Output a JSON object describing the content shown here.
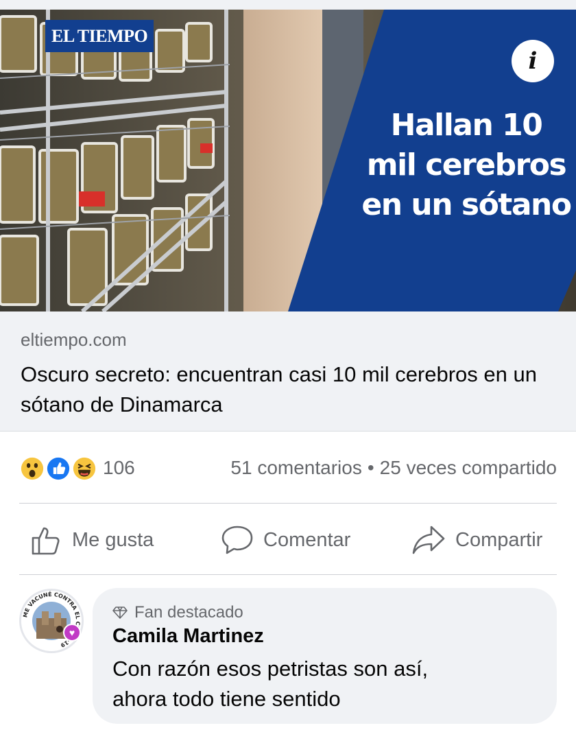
{
  "preview": {
    "logo_text": "EL TIEMPO",
    "headline_lines": [
      "Hallan 10",
      "mil cerebros",
      "en un sótano"
    ],
    "info_icon": "info-icon",
    "brand_blue": "#123f8f"
  },
  "link": {
    "domain": "eltiempo.com",
    "title": "Oscuro secreto: encuentran casi 10 mil cerebros en un sótano de Dinamarca"
  },
  "reactions": {
    "icons": [
      "wow-reaction-icon",
      "like-reaction-icon",
      "haha-reaction-icon"
    ],
    "count": "106",
    "comments": "51 comentarios",
    "separator": "•",
    "shares": "25 veces compartido"
  },
  "actions": {
    "like": {
      "label": "Me gusta",
      "icon": "thumbs-up-icon"
    },
    "comment": {
      "label": "Comentar",
      "icon": "speech-bubble-icon"
    },
    "share": {
      "label": "Compartir",
      "icon": "share-arrow-icon"
    }
  },
  "comment": {
    "badge": "Fan destacado",
    "badge_icon": "diamond-icon",
    "author": "Camila Martinez",
    "text_lines": [
      "Con razón esos petristas son así,",
      "ahora todo tiene sentido"
    ],
    "avatar_frame_text": "ME VACUNÉ CONTRA EL COVID-19"
  }
}
